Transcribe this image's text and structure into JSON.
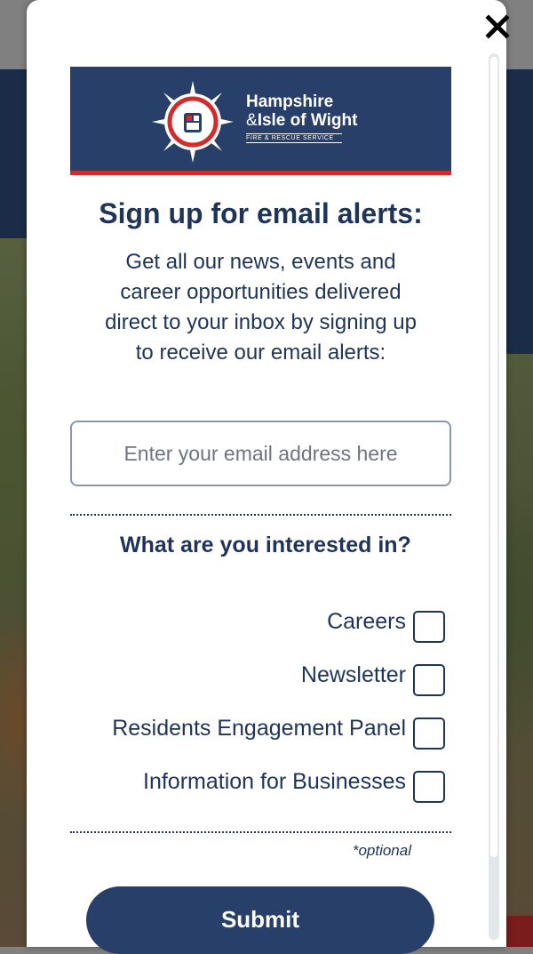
{
  "colors": {
    "navy": "#283f69",
    "text_navy": "#1e3459",
    "brand_red": "#d42a2a"
  },
  "logo": {
    "line1": "Hampshire",
    "line2_amp": "&",
    "line2": "Isle of Wight",
    "line3": "FIRE & RESCUE SERVICE",
    "emblem_icon": "fire-service-star-emblem"
  },
  "modal": {
    "close_icon": "close-icon",
    "title": "Sign up for email alerts:",
    "intro": "Get all our news, events and career opportunities delivered direct to your inbox by signing up to receive our email alerts:",
    "email": {
      "placeholder": "Enter your email address here",
      "value": ""
    },
    "interests_title": "What are you interested in?",
    "options": [
      {
        "label": "Careers",
        "checked": false
      },
      {
        "label": "Newsletter",
        "checked": false
      },
      {
        "label": "Residents Engagement Panel",
        "checked": false
      },
      {
        "label": "Information for Businesses",
        "checked": false
      }
    ],
    "optional_note": "*optional",
    "submit_label": "Submit"
  }
}
